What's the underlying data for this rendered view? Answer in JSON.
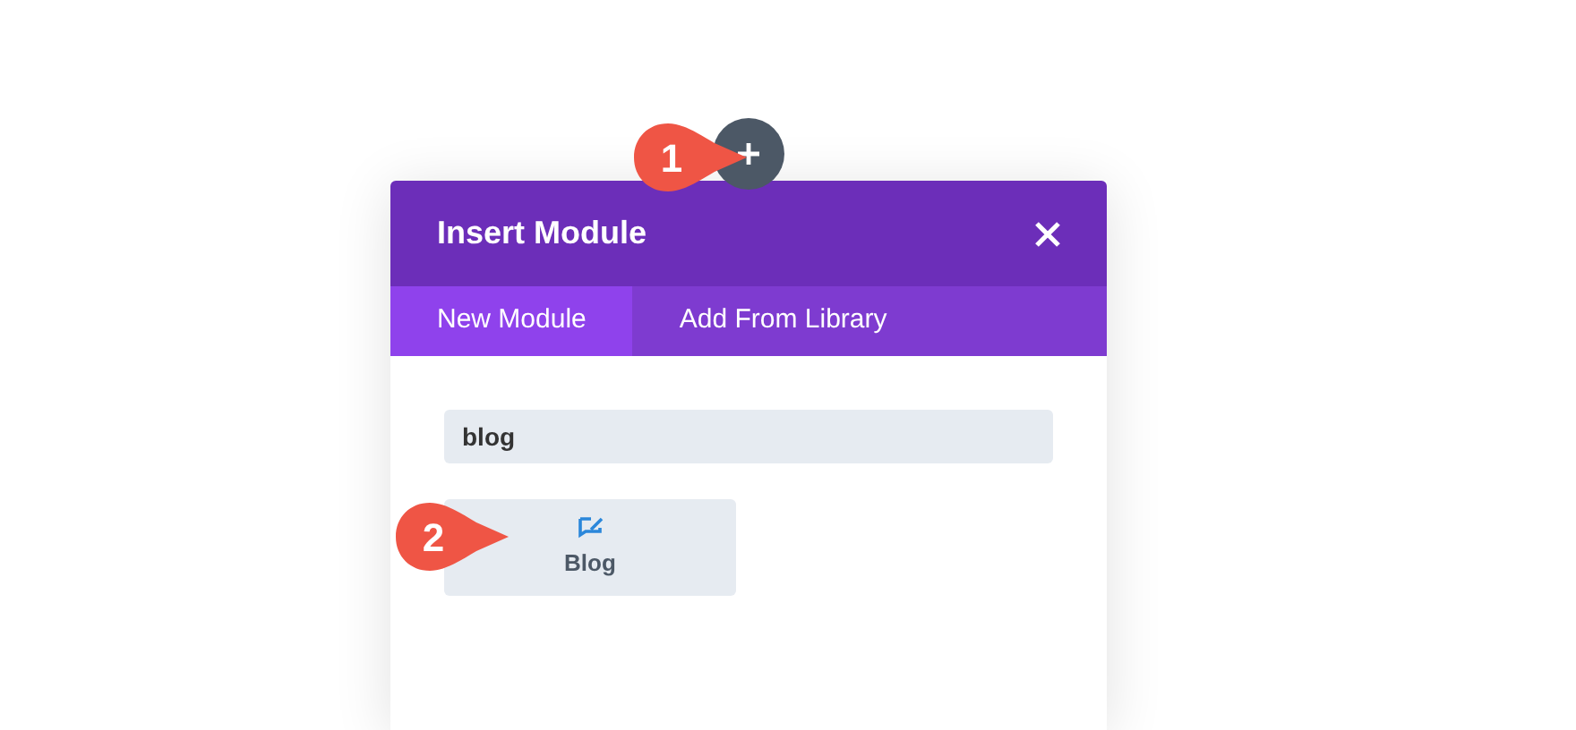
{
  "modal": {
    "title": "Insert Module",
    "tabs": [
      {
        "label": "New Module",
        "selected": true
      },
      {
        "label": "Add From Library",
        "selected": false
      }
    ],
    "search": {
      "value": "blog"
    },
    "modules": [
      {
        "label": "Blog"
      }
    ]
  },
  "callouts": [
    {
      "number": "1"
    },
    {
      "number": "2"
    }
  ]
}
